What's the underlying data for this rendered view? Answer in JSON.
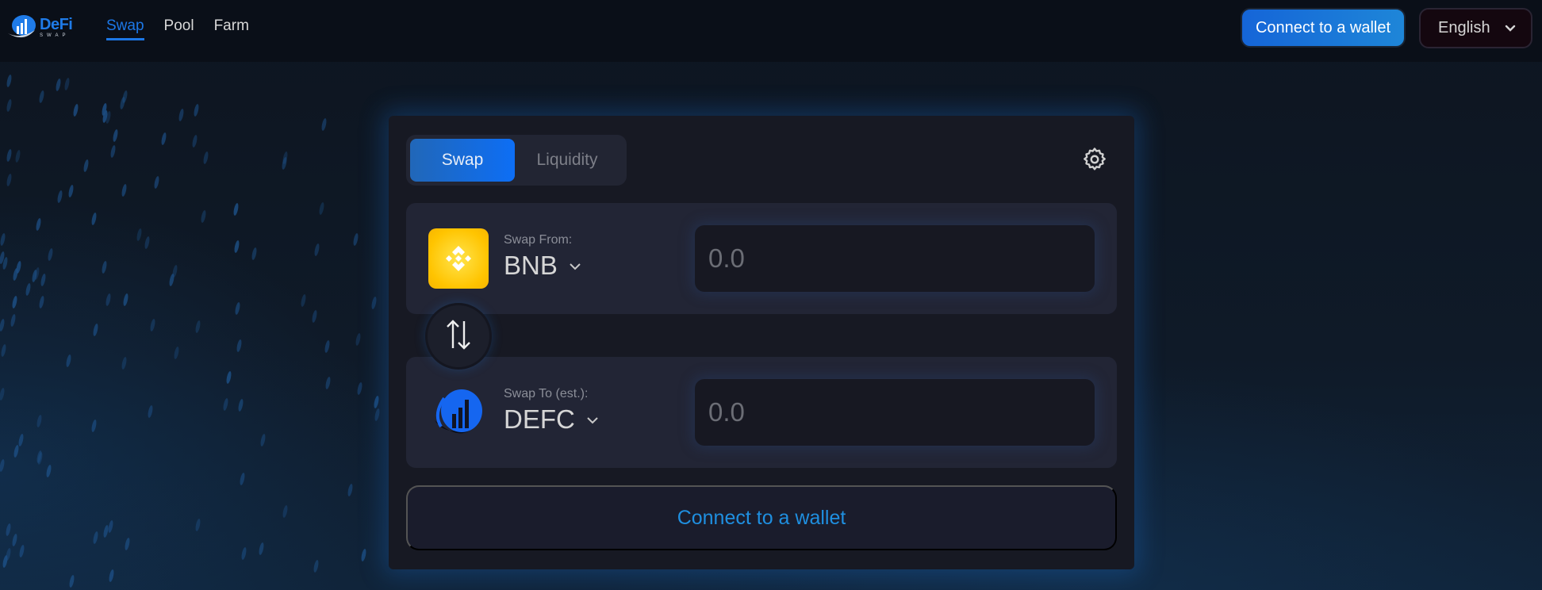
{
  "header": {
    "logo": {
      "title": "DeFi",
      "subtitle": "SWAP"
    },
    "nav": [
      {
        "label": "Swap",
        "active": true
      },
      {
        "label": "Pool",
        "active": false
      },
      {
        "label": "Farm",
        "active": false
      }
    ],
    "connect_label": "Connect to a wallet",
    "language": {
      "selected": "English",
      "icon": "chevron-down-icon"
    }
  },
  "card": {
    "tabs": [
      {
        "label": "Swap",
        "active": true
      },
      {
        "label": "Liquidity",
        "active": false
      }
    ],
    "settings_icon": "gear-icon",
    "from": {
      "label": "Swap From:",
      "token": "BNB",
      "icon": "bnb-icon",
      "amount_placeholder": "0.0",
      "amount_value": ""
    },
    "switch_icon": "swap-arrows-icon",
    "to": {
      "label": "Swap To (est.):",
      "token": "DEFC",
      "icon": "defc-icon",
      "amount_placeholder": "0.0",
      "amount_value": ""
    },
    "connect_label": "Connect to a wallet"
  },
  "colors": {
    "accent": "#1c77e6",
    "connect_text": "#1f8fe0",
    "card_bg": "#171923",
    "panel_bg": "#222535",
    "bnb_yellow": "#ffc400"
  }
}
